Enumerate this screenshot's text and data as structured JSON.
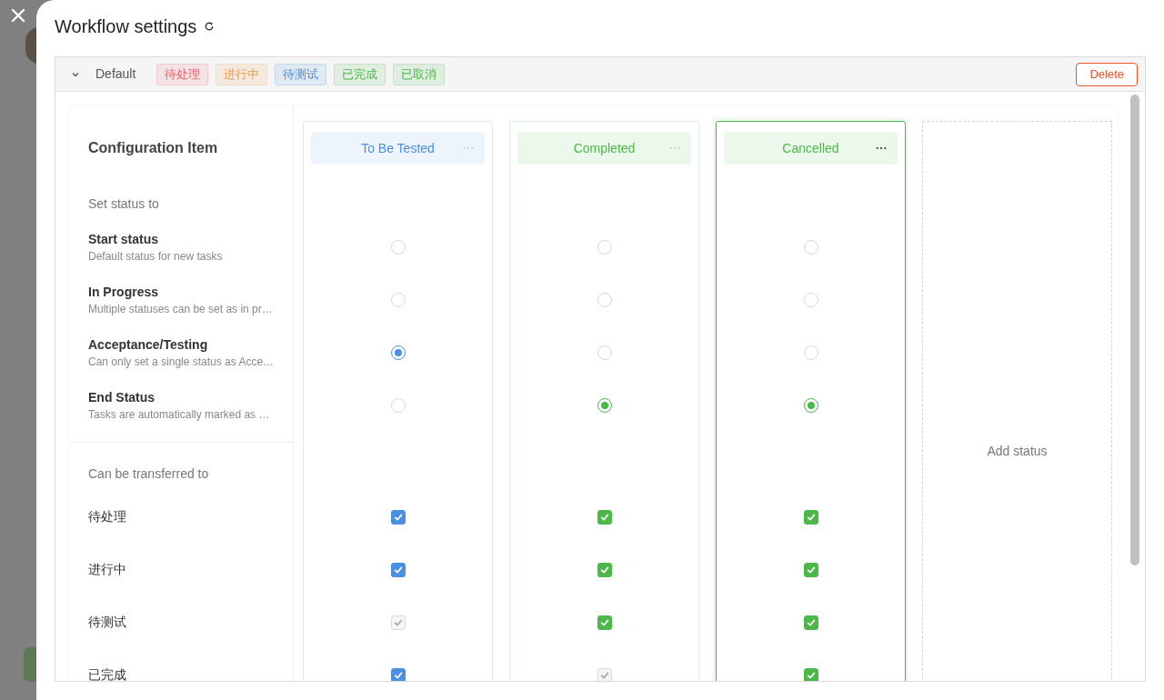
{
  "window": {
    "title": "Workflow settings"
  },
  "workflow": {
    "name": "Default",
    "expanded": true,
    "tags": [
      {
        "label": "待处理",
        "color": "#f0606a"
      },
      {
        "label": "进行中",
        "color": "#f09a4a"
      },
      {
        "label": "待测试",
        "color": "#4a90e2"
      },
      {
        "label": "已完成",
        "color": "#4cb84a"
      },
      {
        "label": "已取消",
        "color": "#4cb84a"
      }
    ],
    "delete_button": "Delete"
  },
  "config": {
    "title": "Configuration Item",
    "set_status_label": "Set status to",
    "status_options": [
      {
        "label": "Start status",
        "description": "Default status for new tasks"
      },
      {
        "label": "In Progress",
        "description": "Multiple statuses can be set as in pr…"
      },
      {
        "label": "Acceptance/Testing",
        "description": "Can only set a single status as Acce…"
      },
      {
        "label": "End Status",
        "description": "Tasks are automatically marked as …"
      }
    ],
    "transfer_label": "Can be transferred to",
    "transfer_targets": [
      "待处理",
      "进行中",
      "待测试",
      "已完成"
    ]
  },
  "columns": [
    {
      "name": "To Be Tested",
      "color": "#4a90e2",
      "selected": false,
      "radios": [
        {
          "selected": false
        },
        {
          "selected": false
        },
        {
          "selected": true
        },
        {
          "selected": false
        }
      ],
      "transfers": [
        {
          "checked": true,
          "disabled": false
        },
        {
          "checked": true,
          "disabled": false
        },
        {
          "checked": true,
          "disabled": true
        },
        {
          "checked": true,
          "disabled": false
        }
      ]
    },
    {
      "name": "Completed",
      "color": "#4cb84a",
      "selected": false,
      "radios": [
        {
          "selected": false
        },
        {
          "selected": false
        },
        {
          "selected": false
        },
        {
          "selected": true
        }
      ],
      "transfers": [
        {
          "checked": true,
          "disabled": false
        },
        {
          "checked": true,
          "disabled": false
        },
        {
          "checked": true,
          "disabled": false
        },
        {
          "checked": true,
          "disabled": true
        }
      ]
    },
    {
      "name": "Cancelled",
      "color": "#4cb84a",
      "selected": true,
      "radios": [
        {
          "selected": false
        },
        {
          "selected": false
        },
        {
          "selected": false
        },
        {
          "selected": true
        }
      ],
      "transfers": [
        {
          "checked": true,
          "disabled": false
        },
        {
          "checked": true,
          "disabled": false
        },
        {
          "checked": true,
          "disabled": false
        },
        {
          "checked": true,
          "disabled": false
        }
      ]
    }
  ],
  "add_status": "Add status"
}
